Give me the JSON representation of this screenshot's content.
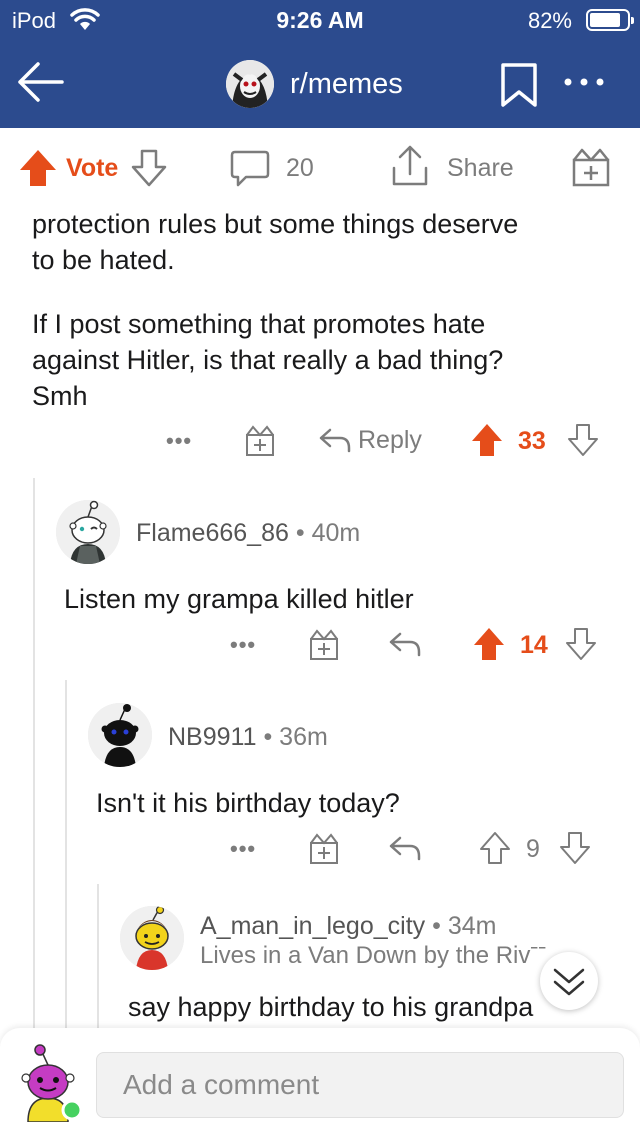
{
  "status_bar": {
    "carrier": "iPod",
    "time": "9:26 AM",
    "battery": "82%",
    "battery_level": 0.82
  },
  "header": {
    "subreddit": "r/memes"
  },
  "action_bar": {
    "vote_label": "Vote",
    "comment_count": "20",
    "share_label": "Share"
  },
  "parent_comment": {
    "lines": [
      "protection rules but some things deserve",
      "to be hated.",
      "If I post something that promotes hate",
      "against Hitler, is that really a bad thing?",
      "Smh"
    ],
    "more": "•••",
    "reply_label": "Reply",
    "score": "33"
  },
  "comments": [
    {
      "author": "Flame666_86",
      "separator": "•",
      "age": "40m",
      "text": "Listen my grampa killed hitler",
      "more": "•••",
      "score": "14"
    },
    {
      "author": "NB9911",
      "separator": "•",
      "age": "36m",
      "text": "Isn't it his birthday today?",
      "more": "•••",
      "score": "9"
    },
    {
      "author": "A_man_in_lego_city",
      "separator": "•",
      "age": "34m",
      "flair": "Lives in a Van Down by the Rivˉˉ",
      "text": "say happy birthday to his grandpa"
    }
  ],
  "composer": {
    "placeholder": "Add a comment"
  },
  "colors": {
    "header_bg": "#2c4b8e",
    "upvote": "#e54d1a",
    "muted": "#7c7c7c"
  },
  "icons": [
    "wifi-icon",
    "back-arrow-icon",
    "bookmark-icon",
    "more-icon",
    "upvote-icon",
    "downvote-icon",
    "comment-icon",
    "share-icon",
    "gift-icon",
    "reply-icon",
    "chevron-double-down-icon"
  ]
}
